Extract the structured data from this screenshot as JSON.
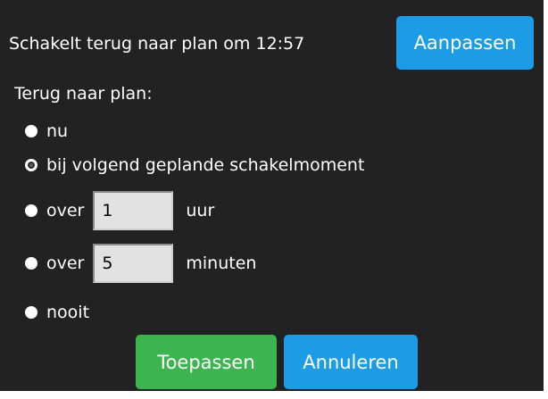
{
  "header": {
    "status_text": "Schakelt terug naar plan om 12:57",
    "adjust_label": "Aanpassen"
  },
  "section": {
    "label": "Terug naar plan:"
  },
  "options": [
    {
      "label": "nu",
      "selected": false
    },
    {
      "label": "bij volgend geplande schakelmoment",
      "selected": true
    },
    {
      "prefix": "over",
      "value": "1",
      "unit": "uur",
      "selected": false
    },
    {
      "prefix": "over",
      "value": "5",
      "unit": "minuten",
      "selected": false
    },
    {
      "label": "nooit",
      "selected": false
    }
  ],
  "actions": {
    "apply_label": "Toepassen",
    "cancel_label": "Annuleren"
  },
  "colors": {
    "panel_bg": "#222222",
    "primary_blue": "#1c9ce6",
    "apply_green": "#3cb450"
  }
}
